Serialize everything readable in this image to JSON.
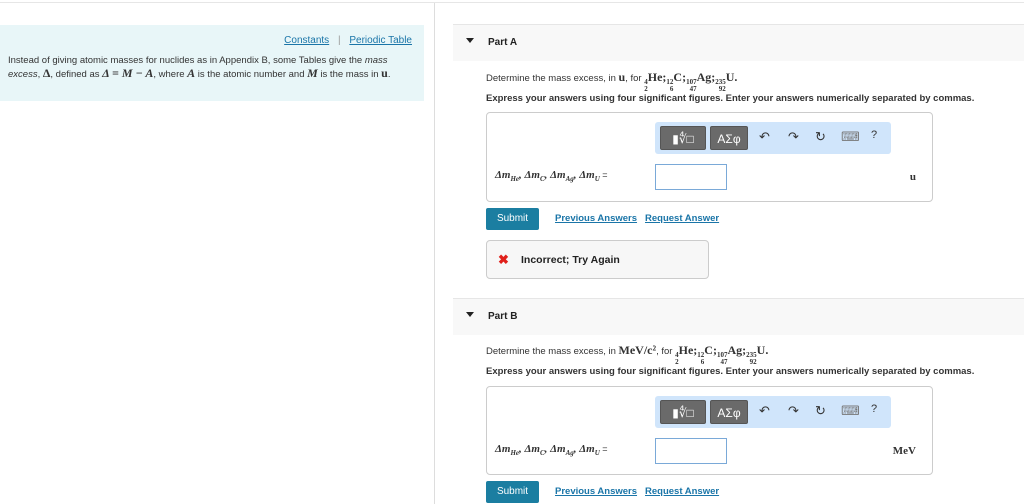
{
  "sidebar": {
    "constants": "Constants",
    "separator": "|",
    "periodic_table": "Periodic Table",
    "intro_1": "Instead of giving atomic masses for nuclides as in Appendix B, some Tables give the ",
    "intro_mass_excess": "mass excess",
    "intro_2": ", ",
    "delta": "Δ",
    "intro_3": ", defined as ",
    "formula": "Δ = M − A",
    "intro_4": ", where ",
    "A": "A",
    "intro_5": " is the atomic number and ",
    "M": "M",
    "intro_6": " is the mass in ",
    "u": "u",
    "intro_7": "."
  },
  "parts": [
    {
      "label": "Part A",
      "question_prefix": "Determine the mass excess, in ",
      "unit_inline": "u",
      "question_for": ", for ",
      "unit": "u"
    },
    {
      "label": "Part B",
      "question_prefix": "Determine the mass excess, in ",
      "unit_inline": "MeV/c²",
      "question_for": ", for ",
      "unit": "MeV"
    }
  ],
  "nuclides": [
    {
      "a": "4",
      "z": "2",
      "sym": "He"
    },
    {
      "a": "12",
      "z": "6",
      "sym": "C"
    },
    {
      "a": "107",
      "z": "47",
      "sym": "Ag"
    },
    {
      "a": "235",
      "z": "92",
      "sym": "U"
    }
  ],
  "instructions": "Express your answers using four significant figures. Enter your answers numerically separated by commas.",
  "toolbar": {
    "templates": "▮∜□",
    "greek": "ΑΣφ",
    "undo": "↶",
    "redo": "↷",
    "reset": "↻",
    "keyboard": "⌨",
    "help": "?"
  },
  "eq": {
    "d": "Δm",
    "he": "He",
    "c": "C",
    "ag": "Ag",
    "u": "U",
    "sep": ", ",
    "eq": " ="
  },
  "actions": {
    "submit": "Submit",
    "previous": "Previous Answers",
    "request": "Request Answer"
  },
  "feedback": {
    "icon": "✖",
    "text": "Incorrect; Try Again"
  },
  "colors": {
    "accent": "#1b7ea1",
    "error": "#e0201b",
    "panel": "#e8f6f8"
  }
}
